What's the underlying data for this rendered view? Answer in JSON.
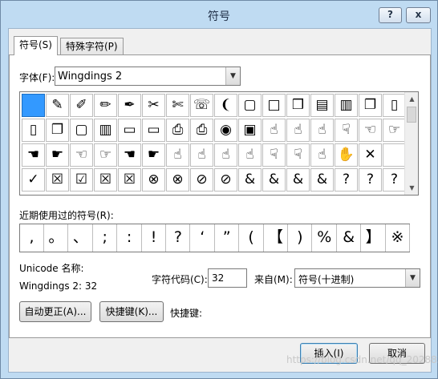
{
  "window": {
    "title": "符号",
    "help_label": "?",
    "close_label": "x"
  },
  "tabs": [
    {
      "label": "符号(S)"
    },
    {
      "label": "特殊字符(P)"
    }
  ],
  "font": {
    "label": "字体(F):",
    "value": "Wingdings 2",
    "dropdown_icon": "chevron-down-icon"
  },
  "symbol_grid": {
    "rows": [
      [
        "",
        "✎",
        "✐",
        "✏",
        "✒",
        "✂",
        "✄",
        "☏",
        "❨",
        "▢",
        "□",
        "❒",
        "▤",
        "▥",
        "❐",
        "▯"
      ],
      [
        "▯",
        "❐",
        "▢",
        "▥",
        "▭",
        "▭",
        "⎙",
        "⎙",
        "◉",
        "▣",
        "☝",
        "☝",
        "☝",
        "☟",
        "☜",
        "☞"
      ],
      [
        "☚",
        "☛",
        "☜",
        "☞",
        "☚",
        "☛",
        "☝",
        "☝",
        "☝",
        "☝",
        "☟",
        "☟",
        "☝",
        "✋",
        "✕",
        ""
      ],
      [
        "✓",
        "☒",
        "☑",
        "☒",
        "☒",
        "⊗",
        "⊗",
        "⊘",
        "⊘",
        "&",
        "&",
        "&",
        "&",
        "?",
        "?",
        "?"
      ]
    ]
  },
  "recent": {
    "label": "近期使用过的符号(R):",
    "symbols": [
      ",",
      "。",
      "、",
      ";",
      ":",
      "!",
      "?",
      "‘",
      "”",
      "(",
      "【",
      ")",
      "%",
      "&",
      "】",
      "※"
    ]
  },
  "unicode_name": {
    "label": "Unicode 名称:",
    "value": "Wingdings 2: 32"
  },
  "char_code": {
    "label": "字符代码(C):",
    "value": "32"
  },
  "from": {
    "label": "来自(M):",
    "value": "符号(十进制)"
  },
  "buttons": {
    "autocorrect": "自动更正(A)...",
    "shortcut_key": "快捷键(K)...",
    "shortcut_label": "快捷键:",
    "insert": "插入(I)",
    "cancel": "取消"
  },
  "watermark": "https://blog.csdn.net/qq_20288327"
}
